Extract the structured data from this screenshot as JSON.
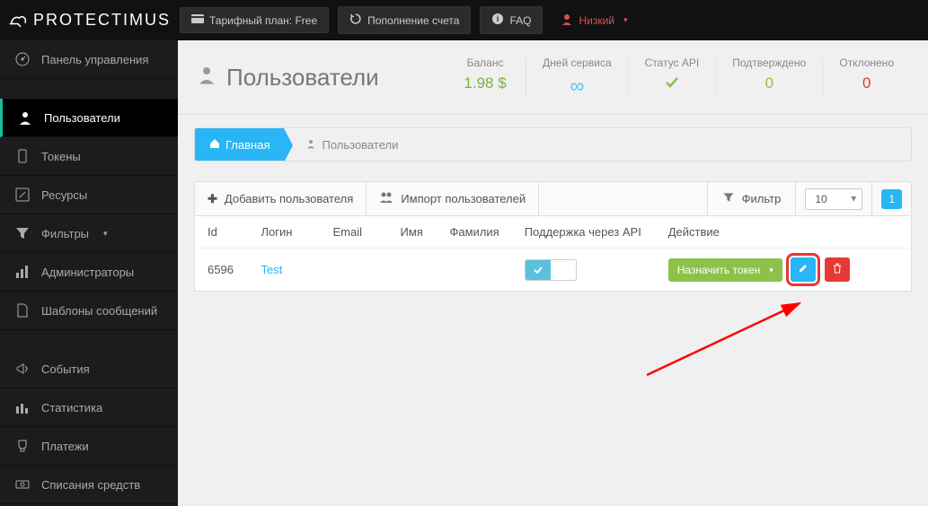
{
  "brand": "PROTECTIMUS",
  "top": {
    "plan": "Тарифный план: Free",
    "topup": "Пополнение счета",
    "faq": "FAQ",
    "user": "Низкий"
  },
  "sidebar": {
    "items": [
      "Панель управления",
      "Пользователи",
      "Токены",
      "Ресурсы",
      "Фильтры",
      "Администраторы",
      "Шаблоны сообщений",
      "События",
      "Статистика",
      "Платежи",
      "Списания средств"
    ]
  },
  "page": {
    "title": "Пользователи",
    "breadcrumb_home": "Главная",
    "breadcrumb_current": "Пользователи"
  },
  "stats": {
    "balance_label": "Баланс",
    "balance_value": "1.98 $",
    "days_label": "Дней сервиса",
    "days_value": "∞",
    "api_label": "Статус API",
    "confirmed_label": "Подтверждено",
    "confirmed_value": "0",
    "declined_label": "Отклонено",
    "declined_value": "0"
  },
  "toolbar": {
    "add_user": "Добавить пользователя",
    "import_users": "Импорт пользователей",
    "filter": "Фильтр",
    "page_size": "10",
    "page": "1"
  },
  "table": {
    "headers": {
      "id": "Id",
      "login": "Логин",
      "email": "Email",
      "name": "Имя",
      "surname": "Фамилия",
      "api": "Поддержка через API",
      "action": "Действие"
    },
    "rows": [
      {
        "id": "6596",
        "login": "Test",
        "email": "",
        "name": "",
        "surname": "",
        "api": true,
        "assign": "Назначить токен"
      }
    ]
  }
}
